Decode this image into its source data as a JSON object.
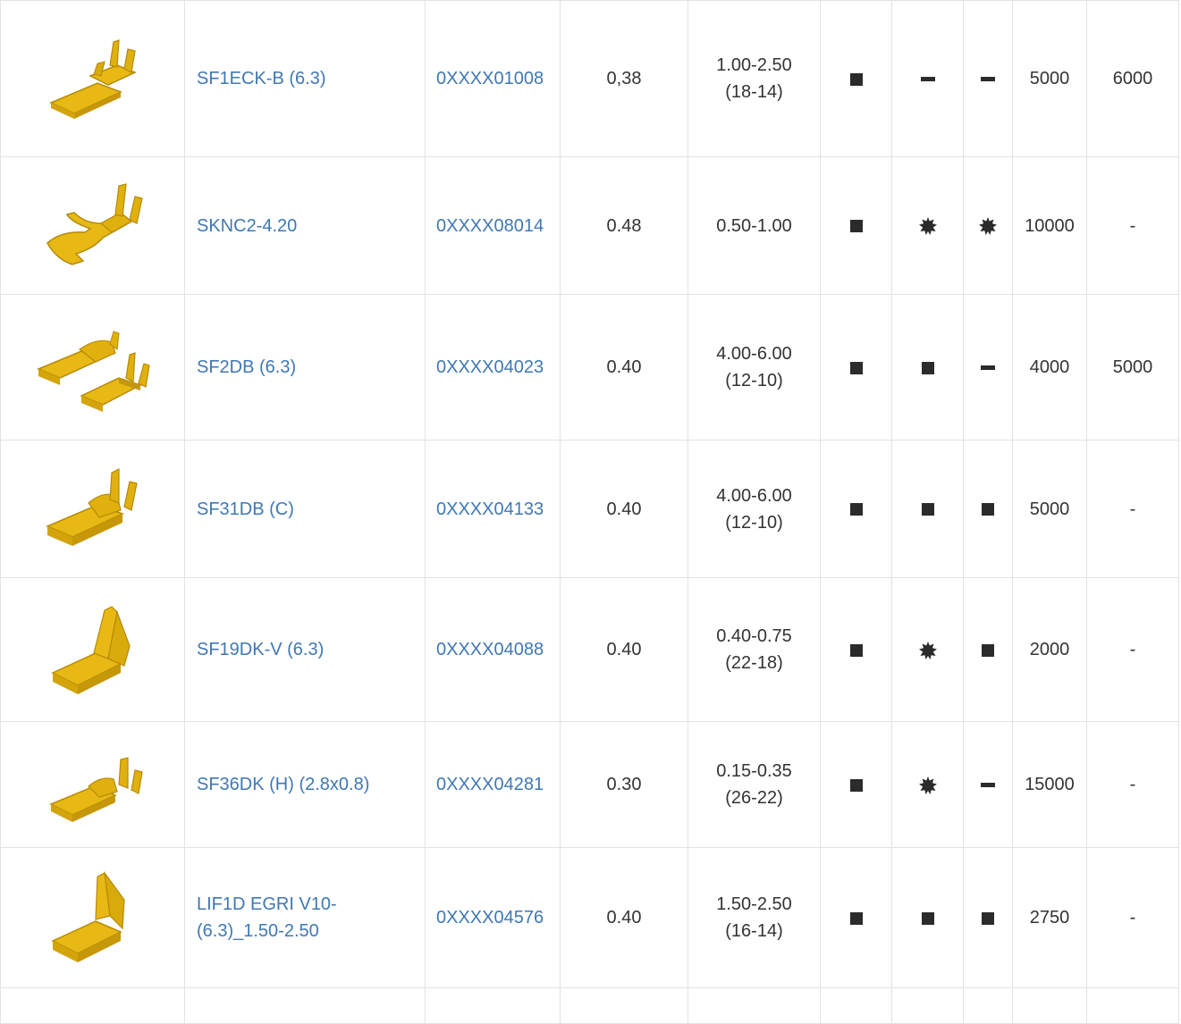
{
  "colors": {
    "link": "#3f78b4",
    "text": "#333333",
    "border": "#e2e2e2",
    "symbol": "#2b2b2b",
    "brass": "#e0b10e",
    "brass_dark": "#b58a06"
  },
  "legend_symbols": {
    "square": "filled-square-icon",
    "dash": "dash-icon",
    "star": "star-burst-icon"
  },
  "rows": [
    {
      "image": "flat-receptacle-terminal-icon",
      "name": "SF1ECK-B (6.3)",
      "name_line2": "",
      "code": "0XXXX01008",
      "thickness": "0,38",
      "wire_range": "1.00-2.50",
      "wire_awg": "(18-14)",
      "col_a": "square",
      "col_b": "dash",
      "col_c": "dash",
      "qty1": "5000",
      "qty2": "6000"
    },
    {
      "image": "fork-terminal-icon",
      "name": "SKNC2-4.20",
      "name_line2": "",
      "code": "0XXXX08014",
      "thickness": "0.48",
      "wire_range": "0.50-1.00",
      "wire_awg": "",
      "col_a": "square",
      "col_b": "star",
      "col_c": "star",
      "qty1": "10000",
      "qty2": "-"
    },
    {
      "image": "double-receptacle-terminal-icon",
      "name": "SF2DB (6.3)",
      "name_line2": "",
      "code": "0XXXX04023",
      "thickness": "0.40",
      "wire_range": "4.00-6.00",
      "wire_awg": "(12-10)",
      "col_a": "square",
      "col_b": "square",
      "col_c": "dash",
      "qty1": "4000",
      "qty2": "5000"
    },
    {
      "image": "receptacle-terminal-icon",
      "name": "SF31DB (C)",
      "name_line2": "",
      "code": "0XXXX04133",
      "thickness": "0.40",
      "wire_range": "4.00-6.00",
      "wire_awg": "(12-10)",
      "col_a": "square",
      "col_b": "square",
      "col_c": "square",
      "qty1": "5000",
      "qty2": "-"
    },
    {
      "image": "flag-receptacle-terminal-icon",
      "name": "SF19DK-V (6.3)",
      "name_line2": "",
      "code": "0XXXX04088",
      "thickness": "0.40",
      "wire_range": "0.40-0.75",
      "wire_awg": "(22-18)",
      "col_a": "square",
      "col_b": "star",
      "col_c": "square",
      "qty1": "2000",
      "qty2": "-"
    },
    {
      "image": "small-receptacle-terminal-icon",
      "name": "SF36DK (H) (2.8x0.8)",
      "name_line2": "",
      "code": "0XXXX04281",
      "thickness": "0.30",
      "wire_range": "0.15-0.35",
      "wire_awg": "(26-22)",
      "col_a": "square",
      "col_b": "star",
      "col_c": "dash",
      "qty1": "15000",
      "qty2": "-"
    },
    {
      "image": "flag-receptacle-terminal-icon",
      "name": "LIF1D EGRI V10-",
      "name_line2": "(6.3)_1.50-2.50",
      "code": "0XXXX04576",
      "thickness": "0.40",
      "wire_range": "1.50-2.50",
      "wire_awg": "(16-14)",
      "col_a": "square",
      "col_b": "square",
      "col_c": "square",
      "qty1": "2750",
      "qty2": "-"
    }
  ]
}
